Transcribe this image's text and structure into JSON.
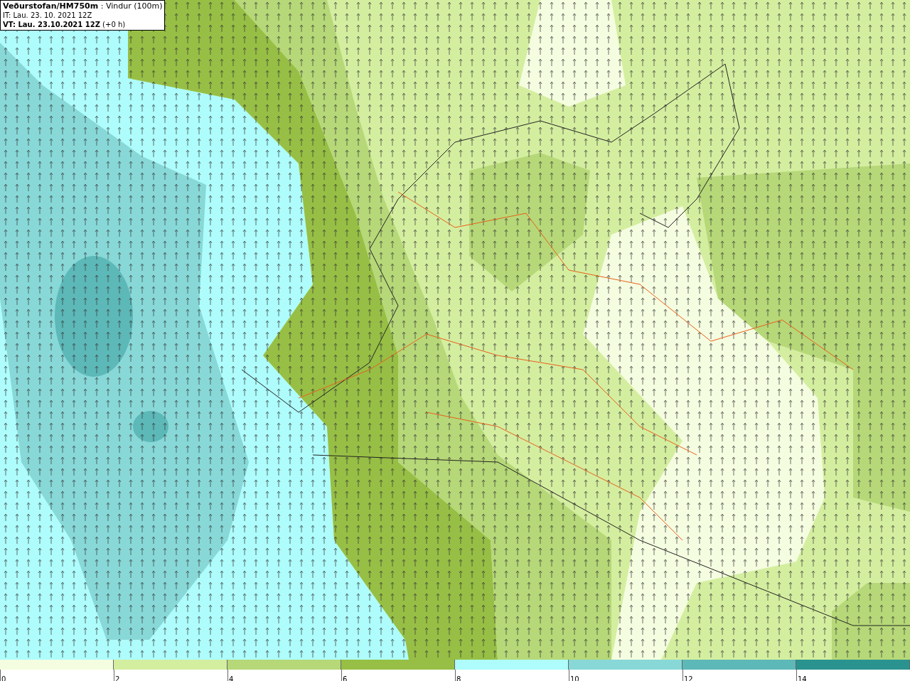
{
  "info_box": {
    "lines": [
      "**Veðurstofan/HM750m** : Vindur (100m)",
      "IT: Lau. 23. 10. 2021 12Z",
      "**VT: Lau. 23.10.2021 12Z** (+0 h)"
    ]
  },
  "legend": {
    "bins": [
      {
        "label": "0",
        "color": "#f5fde0"
      },
      {
        "label": "2",
        "color": "#d4eea0"
      },
      {
        "label": "4",
        "color": "#b6d878"
      },
      {
        "label": "6",
        "color": "#97bf45"
      },
      {
        "label": "8",
        "color": "#aefcfc"
      },
      {
        "label": "10",
        "color": "#88d8d8"
      },
      {
        "label": "12",
        "color": "#5db8b8"
      },
      {
        "label": "14",
        "color": "#2a9390"
      }
    ]
  }
}
